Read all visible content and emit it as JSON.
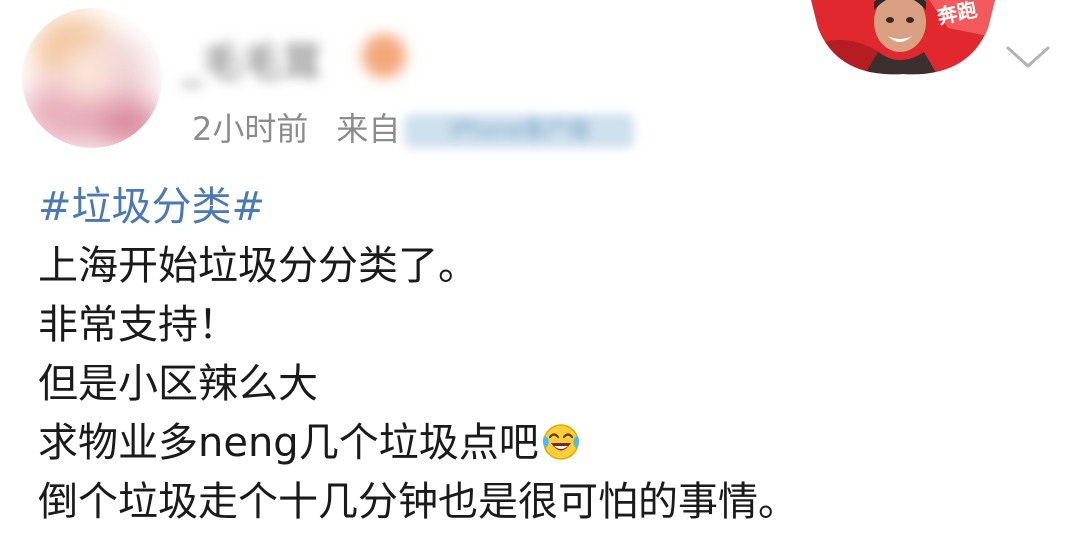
{
  "post": {
    "author": {
      "name": "_毛毛茸"
    },
    "meta": {
      "time": "2小时前",
      "source_prefix": "来自",
      "source": "iPhone客户端"
    },
    "content": {
      "hashtag": "#垃圾分类#",
      "lines": [
        "上海开始垃圾分分类了。",
        "非常支持！",
        "但是小区辣么大",
        "求物业多neng几个垃圾点吧",
        "倒个垃圾走个十几分钟也是很可怕的事情。"
      ],
      "inline_emoji": "laugh-cry-emoji"
    },
    "icons": {
      "menu": "chevron-down-icon",
      "badge": "avatar-badge-icon"
    },
    "colors": {
      "hashtag": "#4a79b3",
      "text": "#1a1a1a",
      "meta": "#8c8c8c",
      "badge_red": "#e0282e"
    }
  }
}
